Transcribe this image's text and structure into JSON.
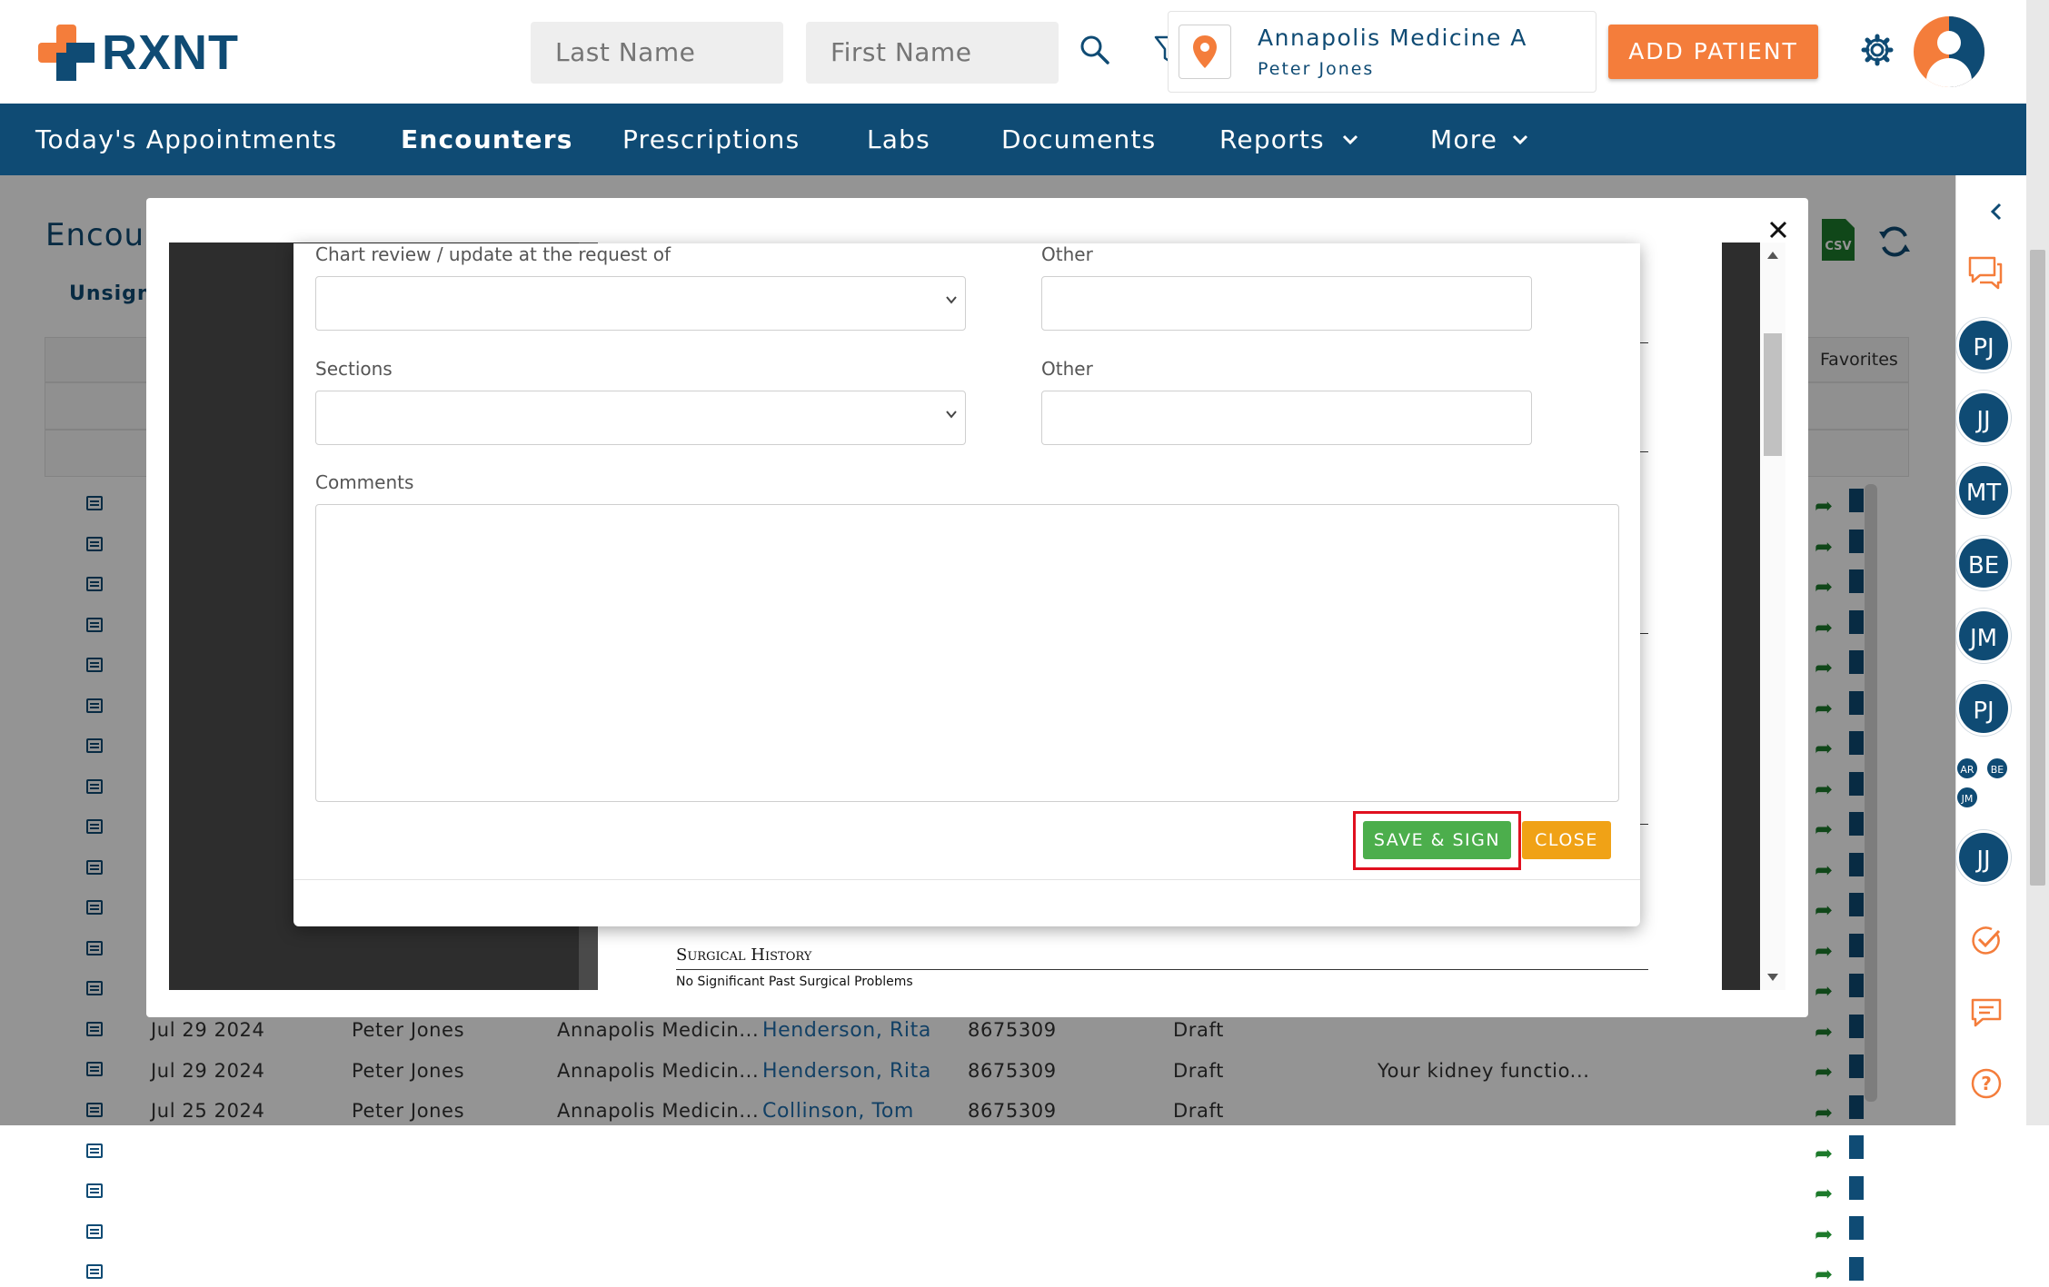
{
  "header": {
    "brand": "RXNT",
    "last_name_placeholder": "Last Name",
    "first_name_placeholder": "First Name",
    "location_name": "Annapolis Medicine A",
    "location_user": "Peter Jones",
    "add_patient_label": "ADD PATIENT",
    "colors": {
      "brand_orange": "#f47d3b",
      "brand_blue": "#0f4b74"
    }
  },
  "nav": {
    "items": [
      {
        "label": "Today's Appointments"
      },
      {
        "label": "Encounters"
      },
      {
        "label": "Prescriptions"
      },
      {
        "label": "Labs"
      },
      {
        "label": "Documents"
      },
      {
        "label": "Reports"
      },
      {
        "label": "More"
      }
    ]
  },
  "page": {
    "title_partial": "Encou",
    "tab_partial": "Unsigne",
    "favorites_label": "Favorites",
    "rows": [
      {
        "date": "Jul 29 2024",
        "provider": "Peter Jones",
        "location": "Annapolis Medicin...",
        "patient": "Henderson, Rita",
        "phone": "8675309",
        "status": "Draft",
        "note": ""
      },
      {
        "date": "Jul 29 2024",
        "provider": "Peter Jones",
        "location": "Annapolis Medicin...",
        "patient": "Henderson, Rita",
        "phone": "8675309",
        "status": "Draft",
        "note": "Your kidney functio..."
      },
      {
        "date": "Jul 25 2024",
        "provider": "Peter Jones",
        "location": "Annapolis Medicin...",
        "patient": "Collinson, Tom",
        "phone": "8675309",
        "status": "Draft",
        "note": ""
      }
    ]
  },
  "rail": {
    "avatars": [
      "PJ",
      "JJ",
      "MT",
      "BE",
      "JM",
      "PJ"
    ],
    "small_avatars": [
      "AR",
      "BE",
      "JM"
    ],
    "bottom_avatar": "JJ"
  },
  "document": {
    "section_heading": "Surgical History",
    "section_text": "No Significant Past Surgical Problems"
  },
  "form": {
    "chart_review_label": "Chart review / update at the request of",
    "other_label_1": "Other",
    "sections_label": "Sections",
    "other_label_2": "Other",
    "comments_label": "Comments",
    "save_sign_label": "SAVE & SIGN",
    "close_label": "CLOSE"
  }
}
